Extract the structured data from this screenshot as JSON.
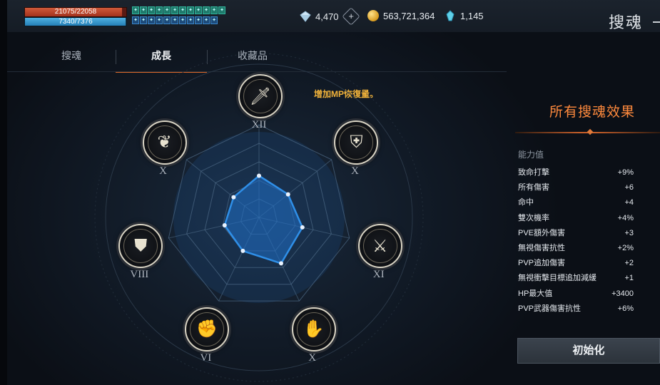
{
  "player": {
    "hp": {
      "text": "21075/22058",
      "current": 21075,
      "max": 22058
    },
    "mp": {
      "text": "7340/7376",
      "current": 7340,
      "max": 7376
    },
    "buff_icons": [
      "rune-icon",
      "rune-icon",
      "rune-icon",
      "rune-icon",
      "rune-icon",
      "rune-icon",
      "rune-icon",
      "rune-icon",
      "rune-icon",
      "rune-icon",
      "rune-icon",
      "rune-icon",
      "rune-icon",
      "rune-icon",
      "rune-icon",
      "rune-icon",
      "rune-icon",
      "rune-icon",
      "rune-icon",
      "rune-icon",
      "rune-icon",
      "rune-icon",
      "rune-icon"
    ]
  },
  "currency": {
    "diamond": "4,470",
    "gold": "563,721,364",
    "crystal": "1,145"
  },
  "page_title": "搜魂",
  "tabs": [
    {
      "label": "搜魂",
      "active": false
    },
    {
      "label": "成長",
      "active": true
    },
    {
      "label": "收藏品",
      "active": false
    }
  ],
  "hint": "增加MP恢復量。",
  "wheel": {
    "nodes": [
      {
        "icon": "sword-icon",
        "roman": "XII"
      },
      {
        "icon": "shield-crest-icon",
        "roman": "X"
      },
      {
        "icon": "weapons-icon",
        "roman": "XI"
      },
      {
        "icon": "gauntlet-icon",
        "roman": "X"
      },
      {
        "icon": "fist-icon",
        "roman": "VI"
      },
      {
        "icon": "armor-icon",
        "roman": "VIII"
      },
      {
        "icon": "feather-icon",
        "roman": "X"
      }
    ],
    "levels": [
      0.45,
      0.4,
      0.48,
      0.55,
      0.4,
      0.38,
      0.35
    ],
    "colors": {
      "accent": "#2f8fe8",
      "fill": "#1f6fc8"
    }
  },
  "panel": {
    "title": "所有搜魂效果",
    "section": "能力值",
    "stats": [
      {
        "name": "致命打擊",
        "value": "+9%"
      },
      {
        "name": "所有傷害",
        "value": "+6"
      },
      {
        "name": "命中",
        "value": "+4"
      },
      {
        "name": "雙次機率",
        "value": "+4%"
      },
      {
        "name": "PVE額外傷害",
        "value": "+3"
      },
      {
        "name": "無視傷害抗性",
        "value": "+2%"
      },
      {
        "name": "PVP追加傷害",
        "value": "+2"
      },
      {
        "name": "無視衝擊目標追加減緩",
        "value": "+1"
      },
      {
        "name": "HP最大值",
        "value": "+3400"
      },
      {
        "name": "PVP武器傷害抗性",
        "value": "+6%"
      }
    ],
    "reset_label": "初始化"
  }
}
